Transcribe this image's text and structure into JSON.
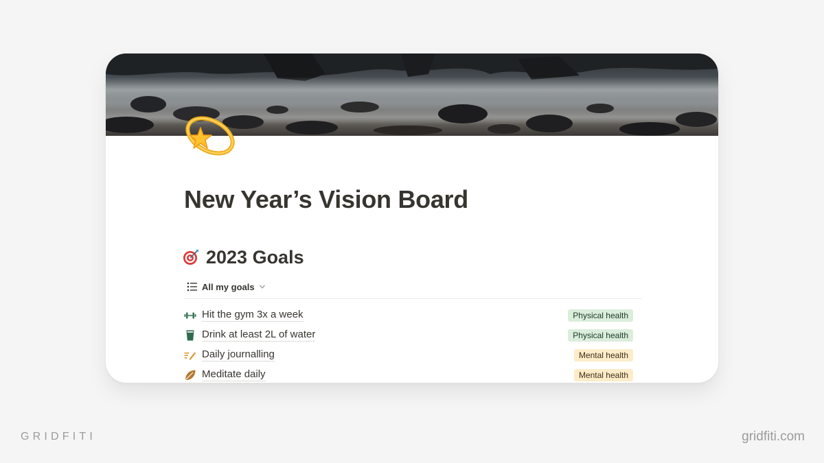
{
  "page": {
    "title": "New Year’s Vision Board",
    "icon": "dizzy-star-icon",
    "cover": "rocky-shoreline-cover"
  },
  "section": {
    "icon": "direct-hit-target-icon",
    "heading": "2023 Goals"
  },
  "view": {
    "icon": "list-icon",
    "label": "All my goals"
  },
  "goals": [
    {
      "icon": "dumbbell-icon",
      "name": "Hit the gym 3x a week",
      "tag": "Physical health"
    },
    {
      "icon": "water-glass-icon",
      "name": "Drink at least 2L of water",
      "tag": "Physical health"
    },
    {
      "icon": "journal-pen-icon",
      "name": "Daily journalling",
      "tag": "Mental health"
    },
    {
      "icon": "leaf-icon",
      "name": "Meditate daily",
      "tag": "Mental health"
    }
  ],
  "tag_colors": {
    "Physical health": {
      "background": "#dbeddb",
      "text": "#1c3829"
    },
    "Mental health": {
      "background": "#fdecc8",
      "text": "#402c1b"
    }
  },
  "branding": {
    "left": "GRIDFITI",
    "right": "gridfiti.com"
  },
  "colors": {
    "background": "#f5f5f5",
    "card": "#ffffff",
    "text": "#37352f",
    "brand": "#9b9b9b"
  }
}
